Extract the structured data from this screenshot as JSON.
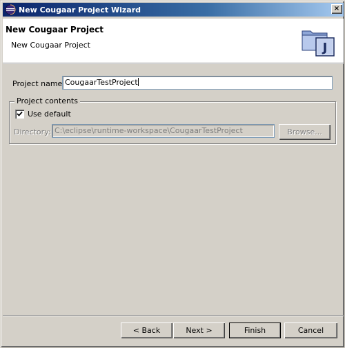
{
  "window": {
    "title": "New Cougaar Project Wizard",
    "close_label": "×",
    "icons": {
      "app": "eclipse-icon",
      "close": "close-icon"
    }
  },
  "header": {
    "title": "New Cougaar Project",
    "description": "New Cougaar Project",
    "image_icon": "java-project-icon",
    "image_letter": "J"
  },
  "form": {
    "project_name_label": "Project name:",
    "project_name_value": "CougaarTestProject",
    "group_label": "Project contents",
    "use_default_label": "Use default",
    "use_default_checked": true,
    "directory_label": "Directory:",
    "directory_value": "C:\\eclipse\\runtime-workspace\\CougaarTestProject",
    "browse_label": "Browse..."
  },
  "buttons": {
    "back": "< Back",
    "next": "Next >",
    "finish": "Finish",
    "cancel": "Cancel"
  },
  "colors": {
    "titlebar_start": "#0a246a",
    "titlebar_end": "#a6caf0",
    "dialog_bg": "#d4d0c8",
    "header_bg": "#ffffff"
  }
}
